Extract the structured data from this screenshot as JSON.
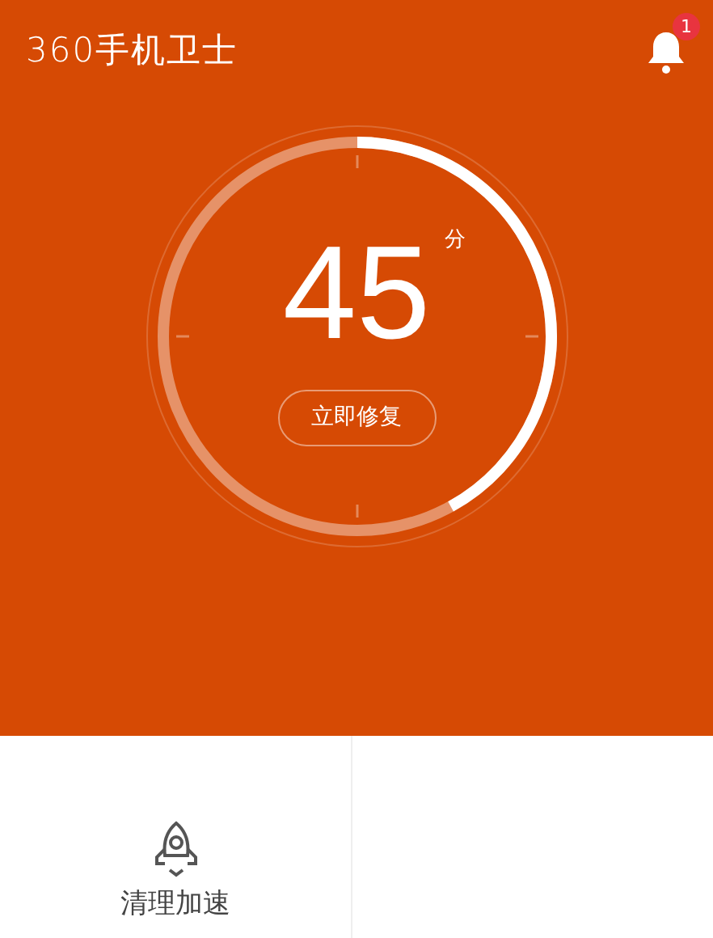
{
  "header": {
    "title": "360手机卫士",
    "notification_count": "1"
  },
  "score": {
    "value": "45",
    "unit": "分",
    "action": "立即修复"
  },
  "tools": [
    {
      "label": "清理加速"
    }
  ]
}
